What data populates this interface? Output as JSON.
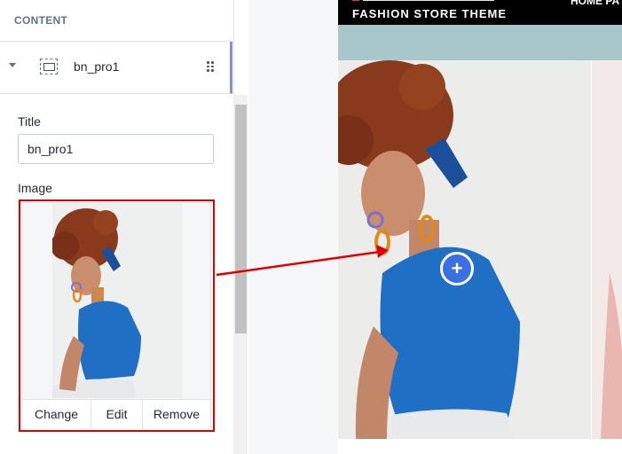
{
  "sidebar": {
    "section_title": "CONTENT",
    "block_label": "bn_pro1",
    "title_field": {
      "label": "Title",
      "value": "bn_pro1"
    },
    "image_field": {
      "label": "Image",
      "actions": [
        "Change",
        "Edit",
        "Remove"
      ]
    }
  },
  "preview": {
    "store_subtitle": "FASHION STORE THEME",
    "nav_text": "HOME PA",
    "hotspot_symbol": "+"
  },
  "colors": {
    "highlight": "#e00000",
    "hotspot": "#3b6fe6",
    "shirt": "#1f6fc4",
    "hair": "#8a3a1c"
  }
}
